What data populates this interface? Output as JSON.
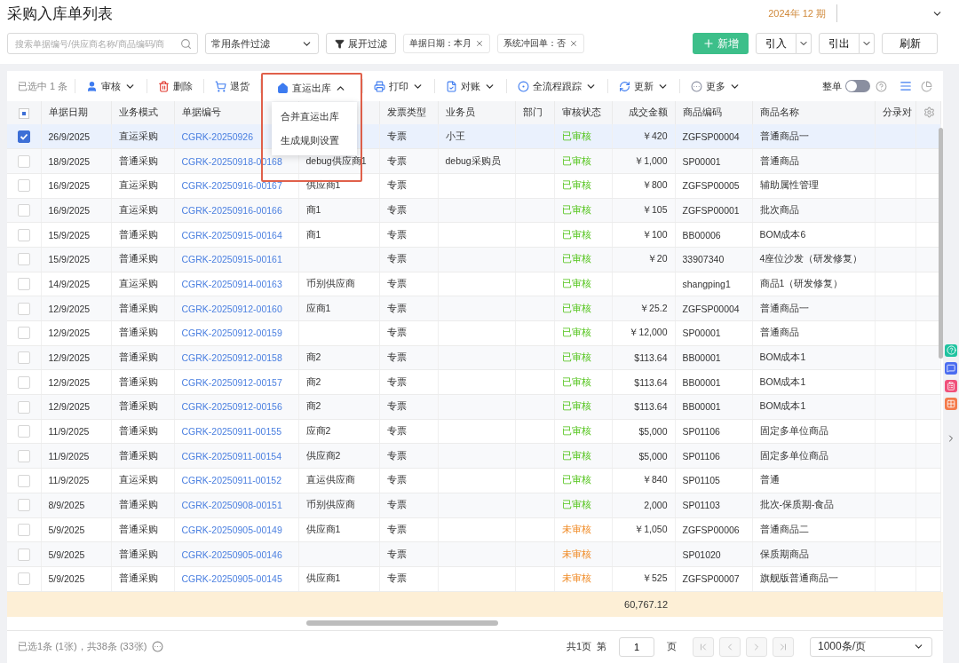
{
  "title": "采购入库单列表",
  "period": "2024年 12 期",
  "search": {
    "placeholder": "搜索单据编号/供应商名称/商品编码/商"
  },
  "filter_select": {
    "value": "常用条件过滤"
  },
  "expand_filter": "展开过滤",
  "filter_tags": [
    {
      "label": "单据日期：本月"
    },
    {
      "label": "系统冲回单：否"
    }
  ],
  "actions": {
    "add": "新增",
    "import": "引入",
    "export": "引出",
    "refresh": "刷新"
  },
  "selected_count": "已选中 1 条",
  "toolbar": [
    {
      "label": "审核",
      "expanded": false
    },
    {
      "label": "删除"
    },
    {
      "label": "退货"
    },
    {
      "label": "直运出库",
      "expanded": true,
      "menu": [
        "合并直运出库",
        "生成规则设置"
      ]
    },
    {
      "label": "打印",
      "expanded": false
    },
    {
      "label": "对账",
      "expanded": false
    },
    {
      "label": "全流程跟踪",
      "expanded": false
    },
    {
      "label": "更新",
      "expanded": false
    },
    {
      "label": "更多",
      "expanded": false
    }
  ],
  "whole_toggle": {
    "label": "整单",
    "on": false
  },
  "select_all": {
    "indeterminate": true
  },
  "columns": [
    "单据日期",
    "业务模式",
    "单据编号",
    "",
    "发票类型",
    "业务员",
    "部门",
    "审核状态",
    "成交金额",
    "商品编码",
    "商品名称",
    "分录对"
  ],
  "rows": [
    {
      "selected": true,
      "date": "26/9/2025",
      "mode": "直运采购",
      "number": "CGRK-20250926",
      "supplier": "",
      "invoice": "专票",
      "salesperson": "小王",
      "status": "已审核",
      "approved": true,
      "amount": "￥420",
      "code": "ZGFSP00004",
      "name": "普通商品一"
    },
    {
      "selected": false,
      "date": "18/9/2025",
      "mode": "普通采购",
      "number": "CGRK-20250918-00168",
      "supplier": "debug供应商1",
      "invoice": "专票",
      "salesperson": "debug采购员",
      "status": "已审核",
      "approved": true,
      "amount": "￥1,000",
      "code": "SP00001",
      "name": "普通商品"
    },
    {
      "selected": false,
      "date": "16/9/2025",
      "mode": "直运采购",
      "number": "CGRK-20250916-00167",
      "supplier": "供应商1",
      "invoice": "专票",
      "salesperson": "",
      "status": "已审核",
      "approved": true,
      "amount": "￥800",
      "code": "ZGFSP00005",
      "name": "辅助属性管理"
    },
    {
      "selected": false,
      "date": "16/9/2025",
      "mode": "直运采购",
      "number": "CGRK-20250916-00166",
      "supplier": "商1",
      "invoice": "专票",
      "salesperson": "",
      "status": "已审核",
      "approved": true,
      "amount": "￥105",
      "code": "ZGFSP00001",
      "name": "批次商品"
    },
    {
      "selected": false,
      "date": "15/9/2025",
      "mode": "普通采购",
      "number": "CGRK-20250915-00164",
      "supplier": "商1",
      "invoice": "专票",
      "salesperson": "",
      "status": "已审核",
      "approved": true,
      "amount": "￥100",
      "code": "BB00006",
      "name": "BOM成本6"
    },
    {
      "selected": false,
      "date": "15/9/2025",
      "mode": "普通采购",
      "number": "CGRK-20250915-00161",
      "supplier": "",
      "invoice": "专票",
      "salesperson": "",
      "status": "已审核",
      "approved": true,
      "amount": "￥20",
      "code": "33907340",
      "name": "4座位沙发（研发修复）"
    },
    {
      "selected": false,
      "date": "14/9/2025",
      "mode": "直运采购",
      "number": "CGRK-20250914-00163",
      "supplier": "币别供应商",
      "invoice": "专票",
      "salesperson": "",
      "status": "已审核",
      "approved": true,
      "amount": "",
      "code": "shangping1",
      "name": "商品1（研发修复）"
    },
    {
      "selected": false,
      "date": "12/9/2025",
      "mode": "普通采购",
      "number": "CGRK-20250912-00160",
      "supplier": "应商1",
      "invoice": "专票",
      "salesperson": "",
      "status": "已审核",
      "approved": true,
      "amount": "￥25.2",
      "code": "ZGFSP00004",
      "name": "普通商品一"
    },
    {
      "selected": false,
      "date": "12/9/2025",
      "mode": "普通采购",
      "number": "CGRK-20250912-00159",
      "supplier": "",
      "invoice": "专票",
      "salesperson": "",
      "status": "已审核",
      "approved": true,
      "amount": "￥12,000",
      "code": "SP00001",
      "name": "普通商品"
    },
    {
      "selected": false,
      "date": "12/9/2025",
      "mode": "普通采购",
      "number": "CGRK-20250912-00158",
      "supplier": "商2",
      "invoice": "专票",
      "salesperson": "",
      "status": "已审核",
      "approved": true,
      "amount": "$113.64",
      "code": "BB00001",
      "name": "BOM成本1"
    },
    {
      "selected": false,
      "date": "12/9/2025",
      "mode": "普通采购",
      "number": "CGRK-20250912-00157",
      "supplier": "商2",
      "invoice": "专票",
      "salesperson": "",
      "status": "已审核",
      "approved": true,
      "amount": "$113.64",
      "code": "BB00001",
      "name": "BOM成本1"
    },
    {
      "selected": false,
      "date": "12/9/2025",
      "mode": "普通采购",
      "number": "CGRK-20250912-00156",
      "supplier": "商2",
      "invoice": "专票",
      "salesperson": "",
      "status": "已审核",
      "approved": true,
      "amount": "$113.64",
      "code": "BB00001",
      "name": "BOM成本1"
    },
    {
      "selected": false,
      "date": "11/9/2025",
      "mode": "普通采购",
      "number": "CGRK-20250911-00155",
      "supplier": "应商2",
      "invoice": "专票",
      "salesperson": "",
      "status": "已审核",
      "approved": true,
      "amount": "$5,000",
      "code": "SP01106",
      "name": "固定多单位商品"
    },
    {
      "selected": false,
      "date": "11/9/2025",
      "mode": "普通采购",
      "number": "CGRK-20250911-00154",
      "supplier": "供应商2",
      "invoice": "专票",
      "salesperson": "",
      "status": "已审核",
      "approved": true,
      "amount": "$5,000",
      "code": "SP01106",
      "name": "固定多单位商品"
    },
    {
      "selected": false,
      "date": "11/9/2025",
      "mode": "直运采购",
      "number": "CGRK-20250911-00152",
      "supplier": "直运供应商",
      "invoice": "专票",
      "salesperson": "",
      "status": "已审核",
      "approved": true,
      "amount": "￥840",
      "code": "SP01105",
      "name": "普通"
    },
    {
      "selected": false,
      "date": "8/9/2025",
      "mode": "普通采购",
      "number": "CGRK-20250908-00151",
      "supplier": "币别供应商",
      "invoice": "专票",
      "salesperson": "",
      "status": "已审核",
      "approved": true,
      "amount": "2,000",
      "code": "SP01103",
      "name": "批次-保质期-食品"
    },
    {
      "selected": false,
      "date": "5/9/2025",
      "mode": "普通采购",
      "number": "CGRK-20250905-00149",
      "supplier": "供应商1",
      "invoice": "专票",
      "salesperson": "",
      "status": "未审核",
      "approved": false,
      "amount": "￥1,050",
      "code": "ZGFSP00006",
      "name": "普通商品二"
    },
    {
      "selected": false,
      "date": "5/9/2025",
      "mode": "普通采购",
      "number": "CGRK-20250905-00146",
      "supplier": "",
      "invoice": "专票",
      "salesperson": "",
      "status": "未审核",
      "approved": false,
      "amount": "",
      "code": "SP01020",
      "name": "保质期商品"
    },
    {
      "selected": false,
      "date": "5/9/2025",
      "mode": "普通采购",
      "number": "CGRK-20250905-00145",
      "supplier": "供应商1",
      "invoice": "专票",
      "salesperson": "",
      "status": "未审核",
      "approved": false,
      "amount": "￥525",
      "code": "ZGFSP00007",
      "name": "旗舰版普通商品一"
    }
  ],
  "total": "60,767.12",
  "footer": {
    "summary": "已选1条 (1张)，共38条 (33张)",
    "pages": "共1页",
    "page_prefix": "第",
    "page": "1",
    "page_suffix": "页",
    "page_size": "1000条/页"
  }
}
